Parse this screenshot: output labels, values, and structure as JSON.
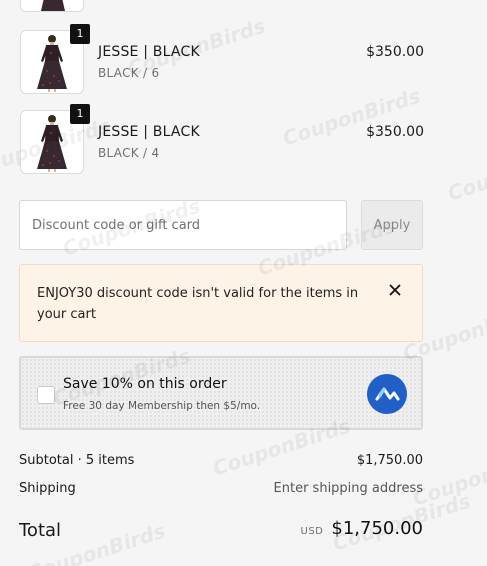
{
  "items": [
    {
      "name": "JESSE | BLACK",
      "variant": "BLACK / 6",
      "price": "$350.00",
      "quantity": "1"
    },
    {
      "name": "JESSE | BLACK",
      "variant": "BLACK / 4",
      "price": "$350.00",
      "quantity": "1"
    }
  ],
  "discount": {
    "placeholder": "Discount code or gift card",
    "value": "",
    "apply_label": "Apply"
  },
  "error": {
    "message": "ENJOY30 discount code isn't valid for the items in your cart",
    "close_icon": "close-icon"
  },
  "membership": {
    "title": "Save 10% on this order",
    "subtitle": "Free 30 day Membership then $5/mo.",
    "checked": false,
    "logo_icon": "membership-logo-icon",
    "logo_color": "#1f5fc7"
  },
  "summary": {
    "subtotal_label": "Subtotal · 5 items",
    "subtotal_value": "$1,750.00",
    "shipping_label": "Shipping",
    "shipping_value": "Enter shipping address",
    "total_label": "Total",
    "currency": "USD",
    "total_value": "$1,750.00"
  },
  "watermark": {
    "text": "CouponBirds"
  }
}
